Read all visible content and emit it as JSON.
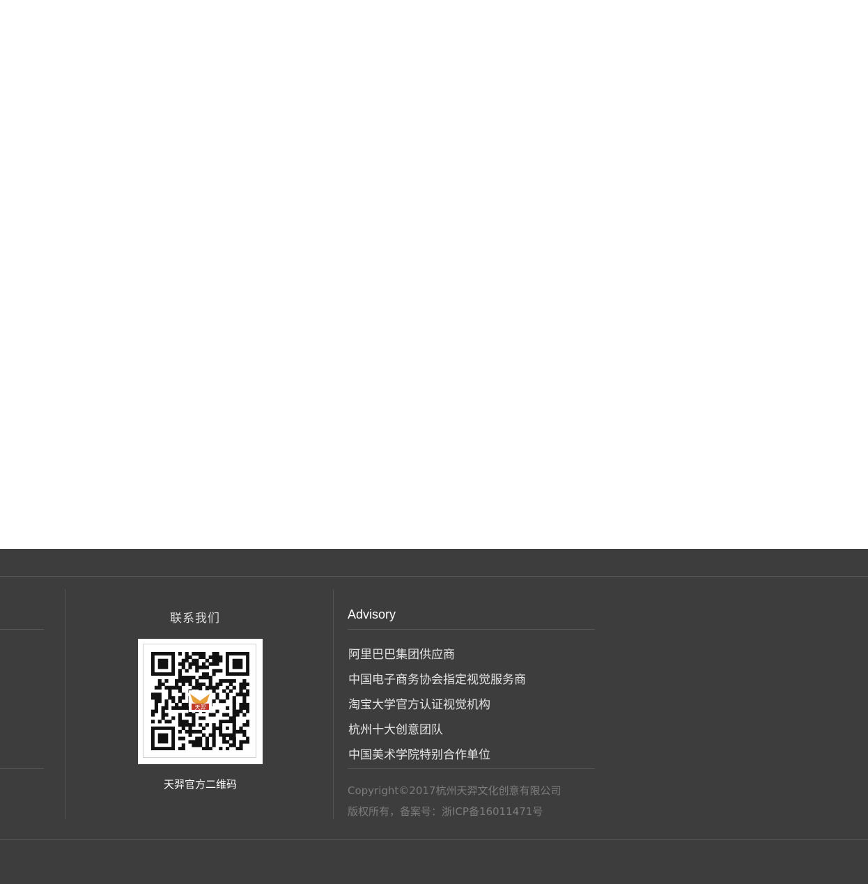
{
  "contact": {
    "title": "联系我们",
    "qr_caption": "天羿官方二维码",
    "qr_logo_text": "天羿"
  },
  "advisory": {
    "title": "Advisory",
    "items": [
      "阿里巴巴集团供应商",
      "中国电子商务协会指定视觉服务商",
      "淘宝大学官方认证视觉机构",
      "杭州十大创意团队",
      "中国美术学院特别合作单位"
    ]
  },
  "copyright": {
    "line1": "Copyright©2017杭州天羿文化创意有限公司",
    "line2": "版权所有，备案号：浙ICP备16011471号"
  },
  "colors": {
    "footer_bg": "#3d3d3d",
    "divider": "#555555",
    "text_light": "#e4e4e4",
    "text_muted": "#7c7c7c",
    "logo_red": "#c0392b",
    "logo_gold": "#e8a13a"
  }
}
